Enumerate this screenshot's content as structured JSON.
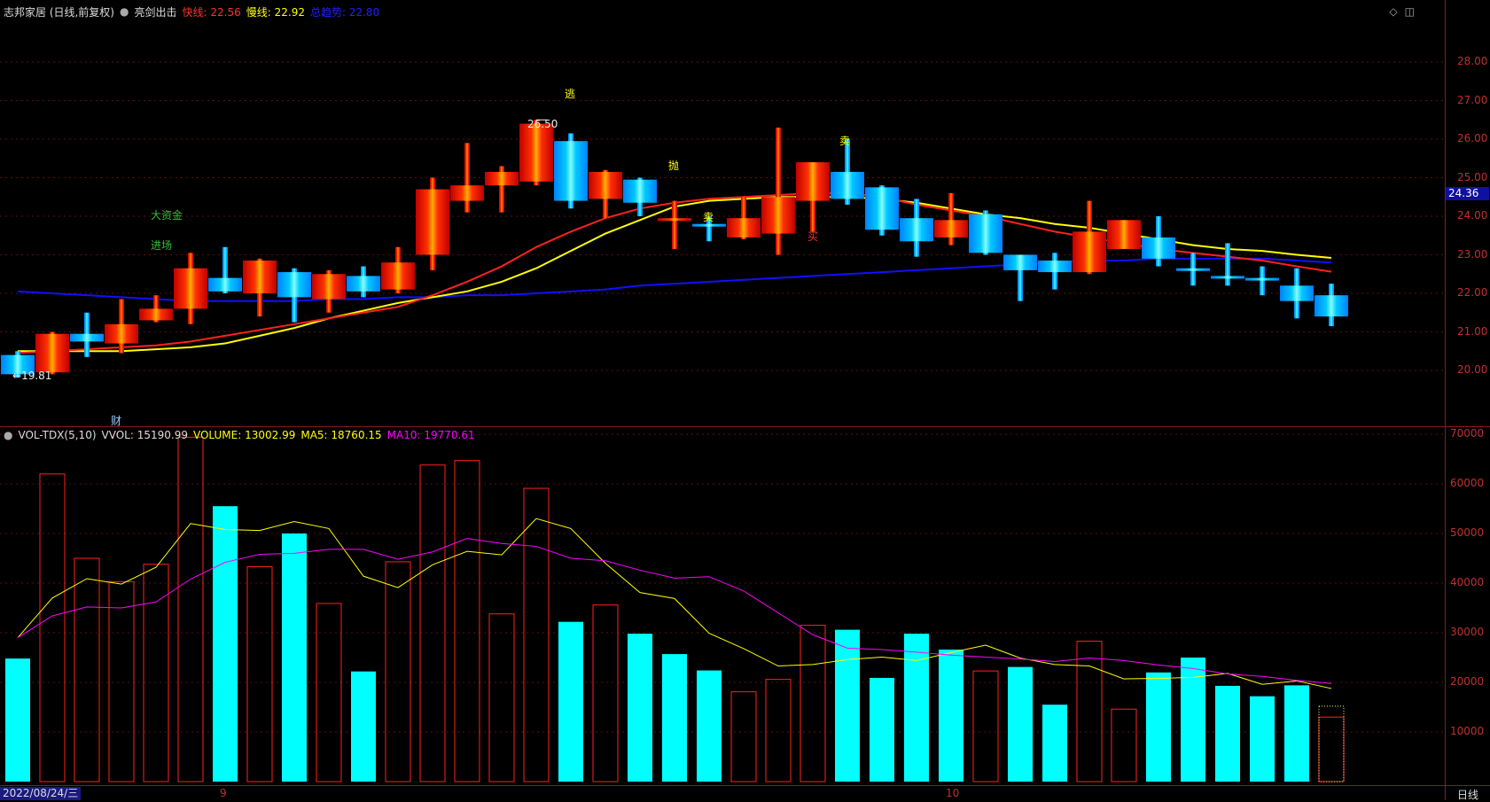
{
  "header": {
    "title": "志邦家居 (日线,前复权)",
    "indicator_name": "亮剑出击",
    "fast_label": "快线:",
    "fast_value": "22.56",
    "slow_label": "慢线:",
    "slow_value": "22.92",
    "third_label": "总趋势:",
    "third_value": "22.80"
  },
  "vol_header": {
    "name": "VOL-TDX(5,10)",
    "vvol": "VVOL: 15190.99",
    "volume": "VOLUME: 13002.99",
    "ma5": "MA5: 18760.15",
    "ma10": "MA10: 19770.61"
  },
  "colors": {
    "up": "#ff2020",
    "down": "#00ffff",
    "fast": "#ff2020",
    "slow": "#ffff00",
    "trend": "#1010ff",
    "ma5": "#ffff00",
    "ma10": "#ff00ff",
    "axis": "#c03030"
  },
  "price_axis": {
    "ticks": [
      "28.00",
      "27.00",
      "26.00",
      "25.00",
      "24.00",
      "23.00",
      "22.00",
      "21.00",
      "20.00"
    ],
    "current": "24.36"
  },
  "volume_axis": {
    "ticks": [
      "70000",
      "60000",
      "50000",
      "40000",
      "30000",
      "20000",
      "10000"
    ]
  },
  "annotations": {
    "high": "26.50",
    "low": "19.81",
    "low_arrow": "←",
    "cai": "财",
    "big_fund": "大资金",
    "enter": "进场",
    "escape": "逃",
    "throw": "抛",
    "sell1": "卖",
    "sell2": "卖",
    "buy": "买"
  },
  "bottom": {
    "date": "2022/08/24/三",
    "month_9": "9",
    "month_10": "10",
    "period": "日线"
  },
  "chart_data": {
    "type": "candlestick",
    "ylim": [
      19.5,
      28.5
    ],
    "candles": [
      {
        "o": 20.4,
        "c": 19.9,
        "h": 20.5,
        "l": 19.81
      },
      {
        "o": 19.95,
        "c": 20.95,
        "h": 21.0,
        "l": 19.9
      },
      {
        "o": 20.95,
        "c": 20.75,
        "h": 21.5,
        "l": 20.35
      },
      {
        "o": 20.7,
        "c": 21.2,
        "h": 21.85,
        "l": 20.45
      },
      {
        "o": 21.3,
        "c": 21.6,
        "h": 21.95,
        "l": 21.25
      },
      {
        "o": 21.6,
        "c": 22.65,
        "h": 23.05,
        "l": 21.2
      },
      {
        "o": 22.4,
        "c": 22.05,
        "h": 23.2,
        "l": 22.0
      },
      {
        "o": 22.0,
        "c": 22.85,
        "h": 22.9,
        "l": 21.4
      },
      {
        "o": 22.55,
        "c": 21.9,
        "h": 22.65,
        "l": 21.25
      },
      {
        "o": 21.85,
        "c": 22.5,
        "h": 22.6,
        "l": 21.5
      },
      {
        "o": 22.45,
        "c": 22.05,
        "h": 22.7,
        "l": 21.9
      },
      {
        "o": 22.1,
        "c": 22.8,
        "h": 23.2,
        "l": 22.0
      },
      {
        "o": 23.0,
        "c": 24.7,
        "h": 25.0,
        "l": 22.6
      },
      {
        "o": 24.4,
        "c": 24.8,
        "h": 25.9,
        "l": 24.1
      },
      {
        "o": 24.8,
        "c": 25.15,
        "h": 25.3,
        "l": 24.1
      },
      {
        "o": 24.9,
        "c": 26.4,
        "h": 26.5,
        "l": 24.8
      },
      {
        "o": 25.95,
        "c": 24.4,
        "h": 26.15,
        "l": 24.2
      },
      {
        "o": 24.45,
        "c": 25.15,
        "h": 25.2,
        "l": 23.95
      },
      {
        "o": 24.95,
        "c": 24.35,
        "h": 25.0,
        "l": 24.0
      },
      {
        "o": 23.95,
        "c": 23.95,
        "h": 24.4,
        "l": 23.15
      },
      {
        "o": 23.8,
        "c": 23.75,
        "h": 24.0,
        "l": 23.35
      },
      {
        "o": 23.45,
        "c": 23.95,
        "h": 24.5,
        "l": 23.4
      },
      {
        "o": 23.55,
        "c": 24.5,
        "h": 26.3,
        "l": 23.0
      },
      {
        "o": 24.4,
        "c": 25.4,
        "h": 25.4,
        "l": 23.6
      },
      {
        "o": 25.15,
        "c": 24.45,
        "h": 26.0,
        "l": 24.3
      },
      {
        "o": 24.75,
        "c": 23.65,
        "h": 24.8,
        "l": 23.5
      },
      {
        "o": 23.95,
        "c": 23.35,
        "h": 24.45,
        "l": 22.95
      },
      {
        "o": 23.45,
        "c": 23.9,
        "h": 24.6,
        "l": 23.25
      },
      {
        "o": 24.05,
        "c": 23.05,
        "h": 24.15,
        "l": 23.0
      },
      {
        "o": 23.0,
        "c": 22.6,
        "h": 23.0,
        "l": 21.8
      },
      {
        "o": 22.85,
        "c": 22.55,
        "h": 23.05,
        "l": 22.1
      },
      {
        "o": 22.55,
        "c": 23.6,
        "h": 24.4,
        "l": 22.5
      },
      {
        "o": 23.15,
        "c": 23.9,
        "h": 23.9,
        "l": 23.15
      },
      {
        "o": 23.45,
        "c": 22.9,
        "h": 24.0,
        "l": 22.7
      },
      {
        "o": 22.65,
        "c": 22.6,
        "h": 23.05,
        "l": 22.2
      },
      {
        "o": 22.45,
        "c": 22.4,
        "h": 23.3,
        "l": 22.2
      },
      {
        "o": 22.4,
        "c": 22.35,
        "h": 22.7,
        "l": 21.95
      },
      {
        "o": 22.2,
        "c": 21.8,
        "h": 22.65,
        "l": 21.35
      },
      {
        "o": 21.95,
        "c": 21.4,
        "h": 22.25,
        "l": 21.15
      }
    ],
    "fast_line": [
      20.45,
      20.5,
      20.55,
      20.6,
      20.65,
      20.75,
      20.9,
      21.05,
      21.2,
      21.35,
      21.5,
      21.65,
      21.95,
      22.3,
      22.7,
      23.2,
      23.6,
      23.95,
      24.2,
      24.35,
      24.45,
      24.5,
      24.55,
      24.6,
      24.6,
      24.5,
      24.3,
      24.15,
      24.0,
      23.8,
      23.6,
      23.45,
      23.3,
      23.15,
      23.05,
      22.95,
      22.85,
      22.7,
      22.56
    ],
    "slow_line": [
      20.5,
      20.5,
      20.5,
      20.5,
      20.55,
      20.6,
      20.7,
      20.9,
      21.1,
      21.35,
      21.55,
      21.75,
      21.9,
      22.05,
      22.3,
      22.65,
      23.1,
      23.55,
      23.9,
      24.25,
      24.4,
      24.45,
      24.5,
      24.5,
      24.5,
      24.45,
      24.35,
      24.2,
      24.05,
      23.95,
      23.8,
      23.7,
      23.55,
      23.4,
      23.25,
      23.15,
      23.1,
      23.0,
      22.92
    ],
    "trend_line": [
      22.05,
      22.0,
      21.95,
      21.9,
      21.85,
      21.8,
      21.8,
      21.8,
      21.8,
      21.85,
      21.85,
      21.9,
      21.9,
      21.95,
      21.95,
      22.0,
      22.05,
      22.1,
      22.2,
      22.25,
      22.3,
      22.35,
      22.4,
      22.45,
      22.5,
      22.55,
      22.6,
      22.65,
      22.7,
      22.75,
      22.8,
      22.85,
      22.85,
      22.9,
      22.9,
      22.9,
      22.9,
      22.85,
      22.8
    ],
    "volume": {
      "ylim": [
        0,
        72000
      ],
      "values": [
        24800,
        62000,
        45000,
        40300,
        43800,
        69400,
        55500,
        43300,
        50000,
        35900,
        22200,
        44300,
        63800,
        64700,
        33800,
        59100,
        32200,
        35600,
        29800,
        25700,
        22400,
        18100,
        20600,
        31500,
        30600,
        20900,
        29800,
        26600,
        22300,
        23100,
        15500,
        28300,
        14600,
        22000,
        25000,
        19300,
        17200,
        19400,
        13000
      ],
      "ma5": [
        29000,
        37000,
        40900,
        39800,
        43200,
        52000,
        50800,
        50600,
        52400,
        51000,
        41400,
        39100,
        43700,
        46400,
        45700,
        53000,
        51000,
        44000,
        38100,
        36900,
        29900,
        26800,
        23300,
        23600,
        24600,
        25100,
        24400,
        26000,
        27500,
        24900,
        23600,
        23300,
        20700,
        20800,
        21000,
        21800,
        19600,
        20300,
        18760
      ],
      "ma10": [
        29000,
        33400,
        35200,
        35000,
        36200,
        40800,
        44200,
        45800,
        46000,
        46800,
        46800,
        44800,
        46300,
        49000,
        48000,
        47400,
        45000,
        44500,
        42600,
        41000,
        41300,
        38400,
        34000,
        29600,
        26900,
        26600,
        26100,
        25500,
        25100,
        24700,
        24200,
        24900,
        24400,
        23500,
        22800,
        21700,
        21200,
        20400,
        19770
      ],
      "up_days": [
        1,
        2,
        3,
        4,
        5,
        7,
        9,
        11,
        12,
        13,
        14,
        15,
        17,
        21,
        22,
        23,
        28,
        31,
        32,
        38
      ]
    }
  }
}
